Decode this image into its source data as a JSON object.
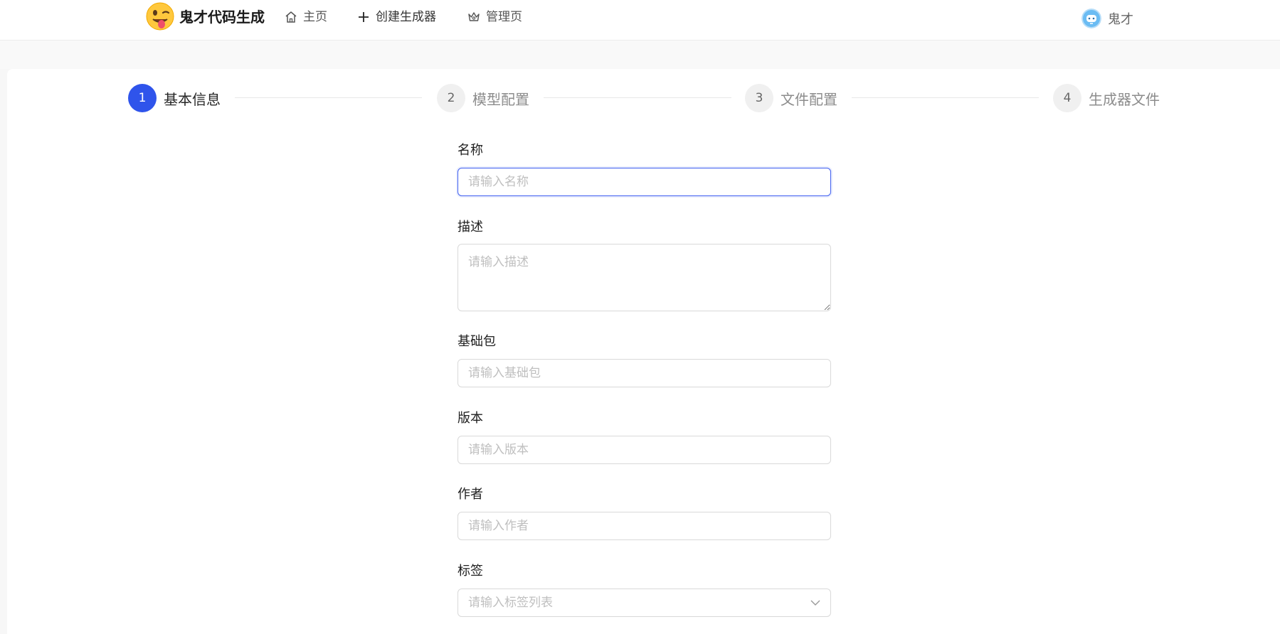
{
  "header": {
    "brand": "鬼才代码生成",
    "nav": [
      {
        "label": "主页",
        "icon": "home-icon"
      },
      {
        "label": "创建生成器",
        "icon": "plus-icon"
      },
      {
        "label": "管理页",
        "icon": "crown-icon"
      }
    ],
    "user": {
      "name": "鬼才",
      "icon": "avatar"
    }
  },
  "steps": [
    {
      "number": "1",
      "title": "基本信息",
      "active": true
    },
    {
      "number": "2",
      "title": "模型配置",
      "active": false
    },
    {
      "number": "3",
      "title": "文件配置",
      "active": false
    },
    {
      "number": "4",
      "title": "生成器文件",
      "active": false
    }
  ],
  "form": {
    "name": {
      "label": "名称",
      "placeholder": "请输入名称",
      "value": ""
    },
    "description": {
      "label": "描述",
      "placeholder": "请输入描述",
      "value": ""
    },
    "base_package": {
      "label": "基础包",
      "placeholder": "请输入基础包",
      "value": ""
    },
    "version": {
      "label": "版本",
      "placeholder": "请输入版本",
      "value": ""
    },
    "author": {
      "label": "作者",
      "placeholder": "请输入作者",
      "value": ""
    },
    "tags": {
      "label": "标签",
      "placeholder": "请输入标签列表",
      "icon": "chevron-down-icon"
    }
  },
  "colors": {
    "primary": "#2f54eb",
    "border": "#d9d9d9",
    "placeholder": "#bfbfbf"
  }
}
